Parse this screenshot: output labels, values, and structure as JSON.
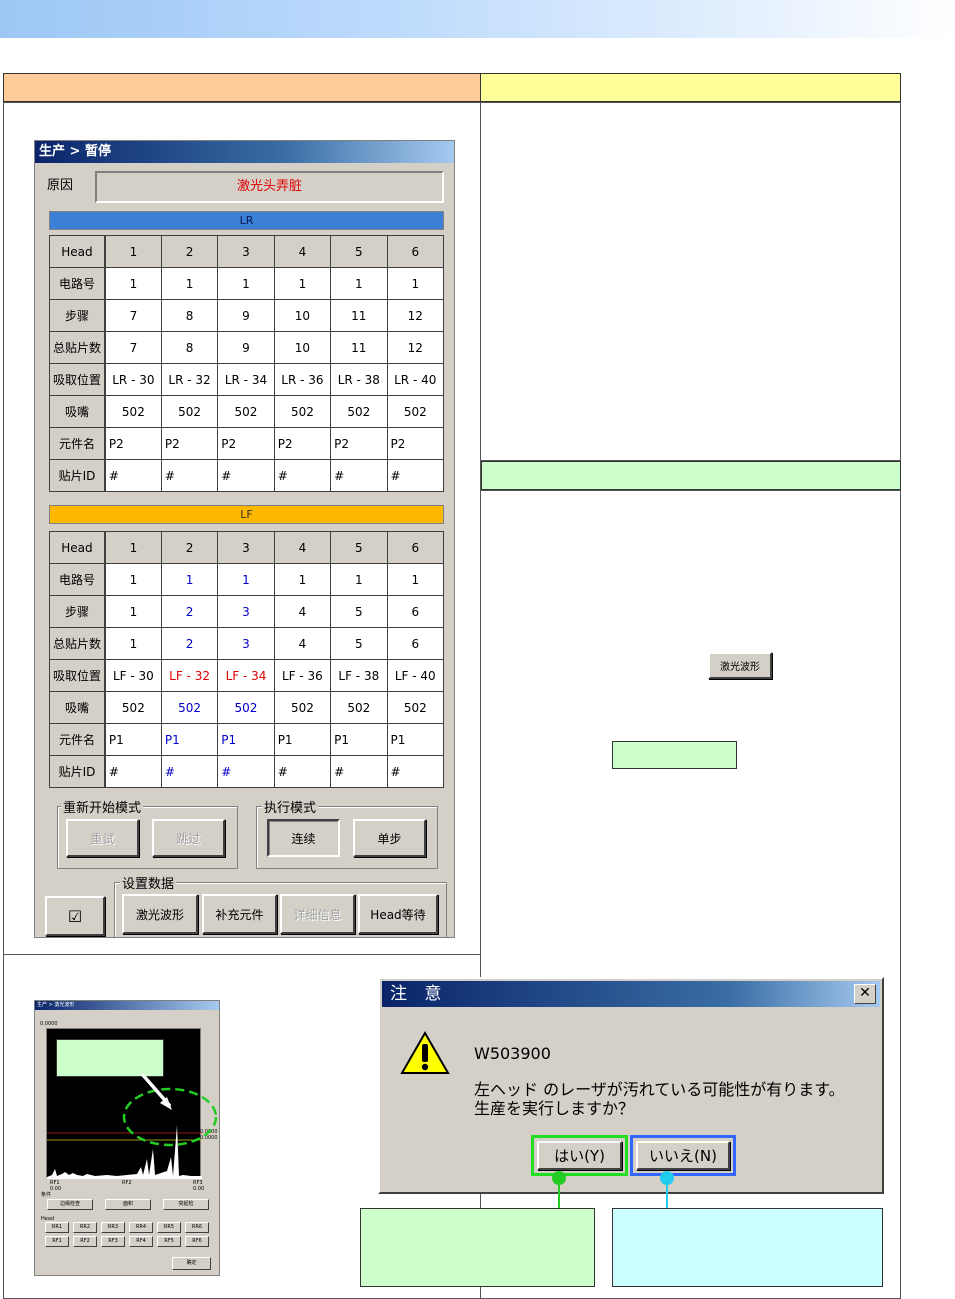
{
  "main": {
    "title": "生产 > 暂停",
    "reason_label": "原因",
    "reason_value": "激光头弄脏",
    "lr_bar": "LR",
    "lf_bar": "LF",
    "lr_table": {
      "header": [
        "Head",
        "1",
        "2",
        "3",
        "4",
        "5",
        "6"
      ],
      "rows": [
        {
          "label": "电路号",
          "cells": [
            "1",
            "1",
            "1",
            "1",
            "1",
            "1"
          ]
        },
        {
          "label": "步骤",
          "cells": [
            "7",
            "8",
            "9",
            "10",
            "11",
            "12"
          ]
        },
        {
          "label": "总贴片数",
          "cells": [
            "7",
            "8",
            "9",
            "10",
            "11",
            "12"
          ]
        },
        {
          "label": "吸取位置",
          "cells": [
            "LR - 30",
            "LR - 32",
            "LR - 34",
            "LR - 36",
            "LR - 38",
            "LR - 40"
          ]
        },
        {
          "label": "吸嘴",
          "cells": [
            "502",
            "502",
            "502",
            "502",
            "502",
            "502"
          ]
        },
        {
          "label": "元件名",
          "cells": [
            "P2",
            "P2",
            "P2",
            "P2",
            "P2",
            "P2"
          ]
        },
        {
          "label": "贴片ID",
          "cells": [
            "#",
            "#",
            "#",
            "#",
            "#",
            "#"
          ]
        }
      ]
    },
    "lf_table": {
      "header": [
        "Head",
        "1",
        "2",
        "3",
        "4",
        "5",
        "6"
      ],
      "rows": [
        {
          "label": "电路号",
          "cells": [
            "1",
            "1",
            "1",
            "1",
            "1",
            "1"
          ]
        },
        {
          "label": "步骤",
          "cells": [
            "1",
            "2",
            "3",
            "4",
            "5",
            "6"
          ]
        },
        {
          "label": "总贴片数",
          "cells": [
            "1",
            "2",
            "3",
            "4",
            "5",
            "6"
          ]
        },
        {
          "label": "吸取位置",
          "cells": [
            "LF - 30",
            "LF - 32",
            "LF - 34",
            "LF - 36",
            "LF - 38",
            "LF - 40"
          ]
        },
        {
          "label": "吸嘴",
          "cells": [
            "502",
            "502",
            "502",
            "502",
            "502",
            "502"
          ]
        },
        {
          "label": "元件名",
          "cells": [
            "P1",
            "P1",
            "P1",
            "P1",
            "P1",
            "P1"
          ]
        },
        {
          "label": "贴片ID",
          "cells": [
            "#",
            "#",
            "#",
            "#",
            "#",
            "#"
          ]
        }
      ]
    },
    "restart_group": "重新开始模式",
    "retry_btn": "重试",
    "skip_btn": "跳过",
    "exec_group": "执行模式",
    "continuous_btn": "连续",
    "step_btn": "单步",
    "settings_group": "设置数据",
    "checkmark_icon": "☑",
    "laser_btn": "激光波形",
    "supply_btn": "补充元件",
    "detail_btn": "详细信息",
    "headwait_btn": "Head等待",
    "colors": {
      "highlight_blue": "#0000cc",
      "highlight_red": "#e00000"
    }
  },
  "side": {
    "laser_btn_small": "激光波形"
  },
  "mini": {
    "title": "生产 > 激光波形",
    "top_value": "0.0000",
    "right_value1": "0.0000",
    "right_value2": "0.0000",
    "axis_left": "RF1\n0.00",
    "axis_mid": "RF2",
    "axis_right": "RF3\n0.00",
    "grp1_label": "条件",
    "btn_a": "边缘检查",
    "btn_b": "面积",
    "btn_c": "突起检",
    "head_label": "Head",
    "row1": [
      "RR1",
      "RR2",
      "RR3",
      "RR4",
      "RR5",
      "RR6"
    ],
    "row2": [
      "RF1",
      "RF2",
      "RF3",
      "RF4",
      "RF5",
      "RF6"
    ],
    "ok_btn": "确定"
  },
  "dialog": {
    "title": "注 意",
    "close": "✕",
    "code": "W503900",
    "line1": "左ヘッド のレーザが汚れている可能性が有ります。",
    "line2": "生産を実行しますか？",
    "yes_btn": "はい(Y)",
    "no_btn": "いいえ(N)"
  }
}
